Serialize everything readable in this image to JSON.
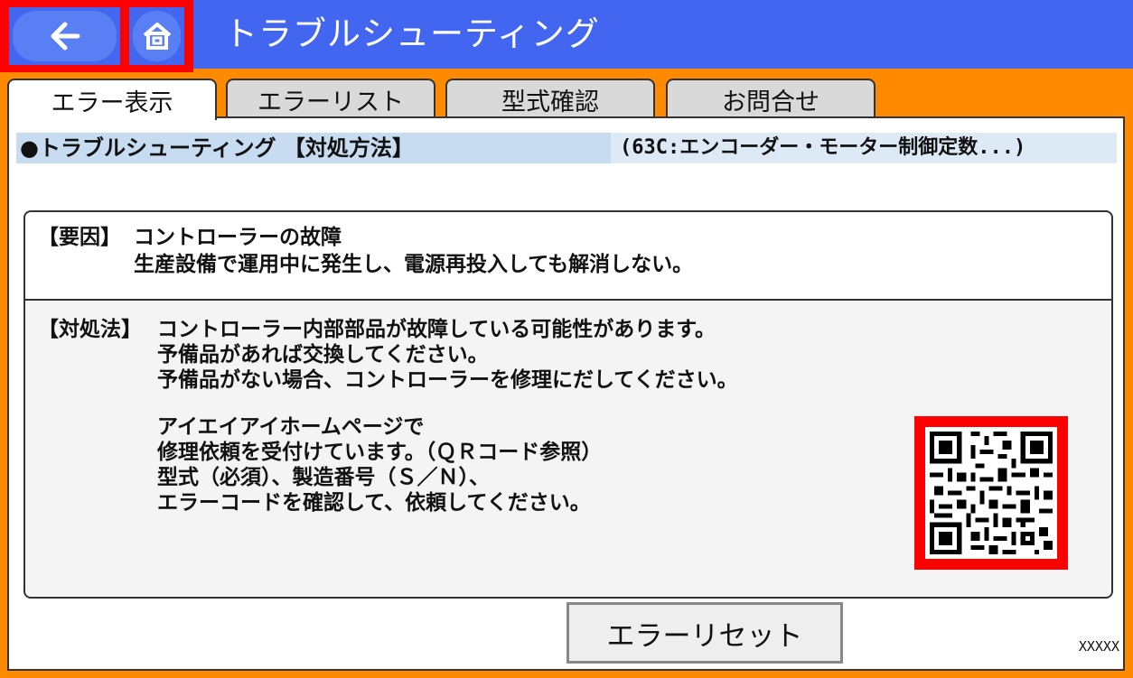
{
  "header": {
    "title": "トラブルシューティング",
    "back_icon": "back-arrow-icon",
    "home_icon": "home-icon",
    "bg_color": "#4266f0",
    "highlight_color": "#ff0000"
  },
  "tabs": [
    {
      "label": "エラー表示",
      "active": true
    },
    {
      "label": "エラーリスト",
      "active": false
    },
    {
      "label": "型式確認",
      "active": false
    },
    {
      "label": "お問合せ",
      "active": false
    }
  ],
  "subheader": {
    "left": "●トラブルシューティング 【対処方法】",
    "right": "(63C:エンコーダー・モーター制御定数...)"
  },
  "cause": {
    "label": "【要因】",
    "title": "コントローラーの故障",
    "detail": "生産設備で運用中に発生し、電源再投入しても解消しない。"
  },
  "remedy": {
    "label": "【対処法】",
    "lines": [
      "コントローラー内部部品が故障している可能性があります。",
      "予備品があれば交換してください。",
      "予備品がない場合、コントローラーを修理にだしてください。",
      "",
      "アイエイアイホームページで",
      "修理依頼を受付けています。（ＱＲコード参照）",
      "型式（必須）、製造番号（Ｓ／Ｎ）、",
      "エラーコードを確認して、依頼してください。"
    ]
  },
  "qr_code": {
    "icon": "qr-code-icon"
  },
  "reset_button": {
    "label": "エラーリセット"
  },
  "footer_code": "XXXXX",
  "accent_color": "#ff8a00"
}
